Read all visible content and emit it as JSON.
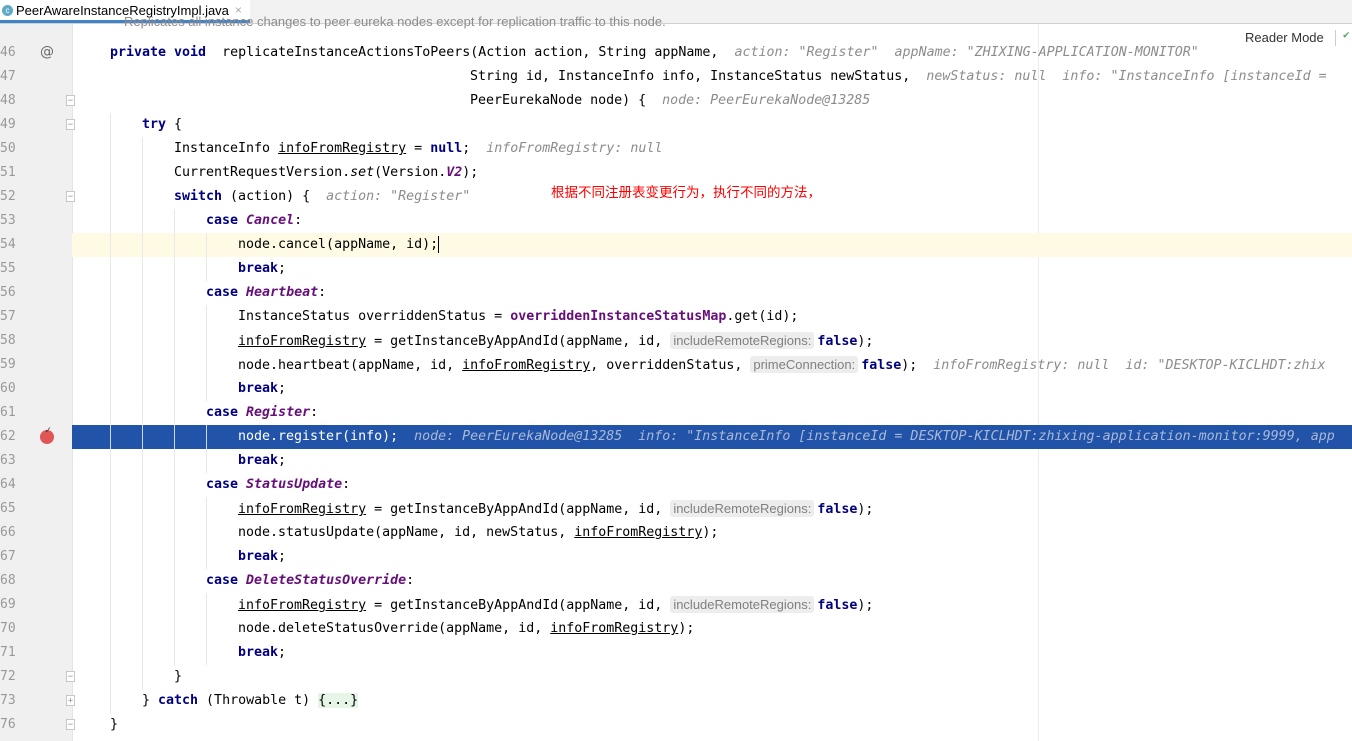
{
  "tab": {
    "icon": "java-class-icon",
    "filename": "PeerAwareInstanceRegistryImpl.java",
    "close": "×"
  },
  "reader_mode": "Reader Mode",
  "doc_comment": "Replicates all instance changes to peer eureka nodes except for replication traffic to this node.",
  "annotation_note": "根据不同注册表变更行为，执行不同的方法，",
  "colors": {
    "current_line": "#2154a8",
    "caret_line": "#fffae3",
    "keyword": "#000080",
    "enum_constant": "#660e7a",
    "note": "#ff0000"
  },
  "lines": [
    {
      "n": "46",
      "indent": 0,
      "gutter": "override-icon",
      "t": [
        [
          "kw",
          "private void"
        ],
        [
          "",
          "  replicateInstanceActionsToPeers(Action action, String appName,"
        ],
        [
          "hint",
          "action: \"Register\""
        ],
        [
          "hint",
          "appName: \"ZHIXING-APPLICATION-MONITOR\""
        ]
      ]
    },
    {
      "n": "47",
      "indent": 0,
      "pad": 45,
      "t": [
        [
          "",
          "String id, InstanceInfo info, InstanceStatus newStatus,"
        ],
        [
          "hint",
          "newStatus: null"
        ],
        [
          "hint",
          "info: \"InstanceInfo [instanceId = "
        ]
      ]
    },
    {
      "n": "48",
      "indent": 0,
      "pad": 45,
      "fold": "-",
      "t": [
        [
          "",
          "PeerEurekaNode node) {"
        ],
        [
          "hint",
          "node: PeerEurekaNode@13285"
        ]
      ]
    },
    {
      "n": "49",
      "indent": 1,
      "fold": "-",
      "t": [
        [
          "kw",
          "try"
        ],
        [
          "",
          " {"
        ]
      ]
    },
    {
      "n": "50",
      "indent": 2,
      "t": [
        [
          "",
          "InstanceInfo "
        ],
        [
          "u",
          "infoFromRegistry"
        ],
        [
          "",
          " = "
        ],
        [
          "kw",
          "null"
        ],
        [
          "",
          ";"
        ],
        [
          "hint",
          "infoFromRegistry: null"
        ]
      ]
    },
    {
      "n": "51",
      "indent": 2,
      "t": [
        [
          "",
          "CurrentRequestVersion."
        ],
        [
          "st",
          "set"
        ],
        [
          "",
          "(Version."
        ],
        [
          "en",
          "V2"
        ],
        [
          "",
          ");"
        ]
      ]
    },
    {
      "n": "52",
      "indent": 2,
      "fold": "-",
      "t": [
        [
          "kw",
          "switch"
        ],
        [
          "",
          " (action) {"
        ],
        [
          "hint",
          "action: \"Register\""
        ]
      ]
    },
    {
      "n": "53",
      "indent": 3,
      "t": [
        [
          "kw",
          "case"
        ],
        [
          "",
          " "
        ],
        [
          "en",
          "Cancel"
        ],
        [
          "",
          ":"
        ]
      ]
    },
    {
      "n": "54",
      "indent": 4,
      "hl": "yellow",
      "caret": true,
      "t": [
        [
          "",
          "node.cancel(appName, id);"
        ]
      ]
    },
    {
      "n": "55",
      "indent": 4,
      "t": [
        [
          "kw",
          "break"
        ],
        [
          "",
          ";"
        ]
      ]
    },
    {
      "n": "56",
      "indent": 3,
      "t": [
        [
          "kw",
          "case"
        ],
        [
          "",
          " "
        ],
        [
          "en",
          "Heartbeat"
        ],
        [
          "",
          ":"
        ]
      ]
    },
    {
      "n": "57",
      "indent": 4,
      "t": [
        [
          "",
          "InstanceStatus overriddenStatus = "
        ],
        [
          "fld",
          "overriddenInstanceStatusMap"
        ],
        [
          "",
          ".get(id);"
        ]
      ]
    },
    {
      "n": "58",
      "indent": 4,
      "t": [
        [
          "u",
          "infoFromRegistry"
        ],
        [
          "",
          " = getInstanceByAppAndId(appName, id, "
        ],
        [
          "inlay",
          "includeRemoteRegions:"
        ],
        [
          "kw",
          "false"
        ],
        [
          "",
          ");"
        ]
      ]
    },
    {
      "n": "59",
      "indent": 4,
      "t": [
        [
          "",
          "node.heartbeat(appName, id, "
        ],
        [
          "u",
          "infoFromRegistry"
        ],
        [
          "",
          ", overriddenStatus, "
        ],
        [
          "inlay",
          "primeConnection:"
        ],
        [
          "kw",
          "false"
        ],
        [
          "",
          ");"
        ],
        [
          "hint",
          "infoFromRegistry: null"
        ],
        [
          "hint",
          "id: \"DESKTOP-KICLHDT:zhix"
        ]
      ]
    },
    {
      "n": "60",
      "indent": 4,
      "t": [
        [
          "kw",
          "break"
        ],
        [
          "",
          ";"
        ]
      ]
    },
    {
      "n": "61",
      "indent": 3,
      "t": [
        [
          "kw",
          "case"
        ],
        [
          "",
          " "
        ],
        [
          "en",
          "Register"
        ],
        [
          "",
          ":"
        ]
      ]
    },
    {
      "n": "62",
      "indent": 4,
      "hl": "blue",
      "gutter": "breakpoint",
      "t": [
        [
          "",
          "node.register(info);"
        ],
        [
          "hint",
          "node: PeerEurekaNode@13285"
        ],
        [
          "hint",
          "info: \"InstanceInfo [instanceId = DESKTOP-KICLHDT:zhixing-application-monitor:9999, app"
        ]
      ]
    },
    {
      "n": "63",
      "indent": 4,
      "t": [
        [
          "kw",
          "break"
        ],
        [
          "",
          ";"
        ]
      ]
    },
    {
      "n": "64",
      "indent": 3,
      "t": [
        [
          "kw",
          "case"
        ],
        [
          "",
          " "
        ],
        [
          "en",
          "StatusUpdate"
        ],
        [
          "",
          ":"
        ]
      ]
    },
    {
      "n": "65",
      "indent": 4,
      "t": [
        [
          "u",
          "infoFromRegistry"
        ],
        [
          "",
          " = getInstanceByAppAndId(appName, id, "
        ],
        [
          "inlay",
          "includeRemoteRegions:"
        ],
        [
          "kw",
          "false"
        ],
        [
          "",
          ");"
        ]
      ]
    },
    {
      "n": "66",
      "indent": 4,
      "t": [
        [
          "",
          "node.statusUpdate(appName, id, newStatus, "
        ],
        [
          "u",
          "infoFromRegistry"
        ],
        [
          "",
          ");"
        ]
      ]
    },
    {
      "n": "67",
      "indent": 4,
      "t": [
        [
          "kw",
          "break"
        ],
        [
          "",
          ";"
        ]
      ]
    },
    {
      "n": "68",
      "indent": 3,
      "t": [
        [
          "kw",
          "case"
        ],
        [
          "",
          " "
        ],
        [
          "en",
          "DeleteStatusOverride"
        ],
        [
          "",
          ":"
        ]
      ]
    },
    {
      "n": "69",
      "indent": 4,
      "t": [
        [
          "u",
          "infoFromRegistry"
        ],
        [
          "",
          " = getInstanceByAppAndId(appName, id, "
        ],
        [
          "inlay",
          "includeRemoteRegions:"
        ],
        [
          "kw",
          "false"
        ],
        [
          "",
          ");"
        ]
      ]
    },
    {
      "n": "70",
      "indent": 4,
      "t": [
        [
          "",
          "node.deleteStatusOverride(appName, id, "
        ],
        [
          "u",
          "infoFromRegistry"
        ],
        [
          "",
          ");"
        ]
      ]
    },
    {
      "n": "71",
      "indent": 4,
      "t": [
        [
          "kw",
          "break"
        ],
        [
          "",
          ";"
        ]
      ]
    },
    {
      "n": "72",
      "indent": 2,
      "fold": "-",
      "t": [
        [
          "",
          "}"
        ]
      ]
    },
    {
      "n": "73",
      "indent": 1,
      "fold": "+",
      "t": [
        [
          "",
          "} "
        ],
        [
          "kw",
          "catch"
        ],
        [
          "",
          " (Throwable t) "
        ],
        [
          "fold",
          "{...}"
        ]
      ]
    },
    {
      "n": "76",
      "indent": 0,
      "fold": "-",
      "t": [
        [
          "",
          "}"
        ]
      ]
    }
  ]
}
